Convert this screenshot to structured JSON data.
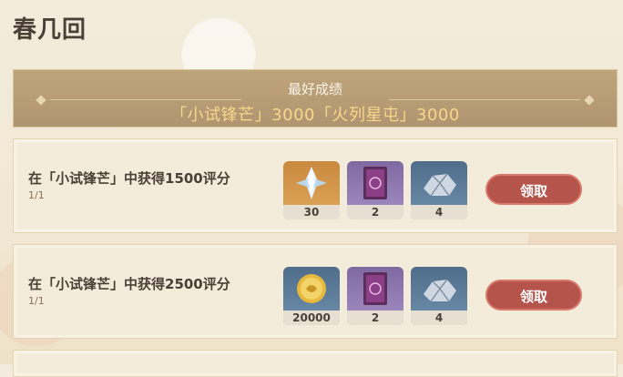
{
  "page": {
    "title": "春几回"
  },
  "best": {
    "label": "最好成绩",
    "scores": "「小试锋芒」3000「火列星屯」3000"
  },
  "tasks": [
    {
      "text": "在「小试锋芒」中获得1500评分",
      "progress": "1/1",
      "rewards": [
        {
          "icon": "primogem-icon",
          "count": "30"
        },
        {
          "icon": "book-icon",
          "count": "2"
        },
        {
          "icon": "ore-icon",
          "count": "4"
        }
      ],
      "button": "领取"
    },
    {
      "text": "在「小试锋芒」中获得2500评分",
      "progress": "1/1",
      "rewards": [
        {
          "icon": "mora-icon",
          "count": "20000"
        },
        {
          "icon": "book-icon",
          "count": "2"
        },
        {
          "icon": "ore-icon",
          "count": "4"
        }
      ],
      "button": "领取"
    }
  ],
  "colors": {
    "button": "#b4544a",
    "banner": "#b09571",
    "score_text": "#f7d88a"
  }
}
